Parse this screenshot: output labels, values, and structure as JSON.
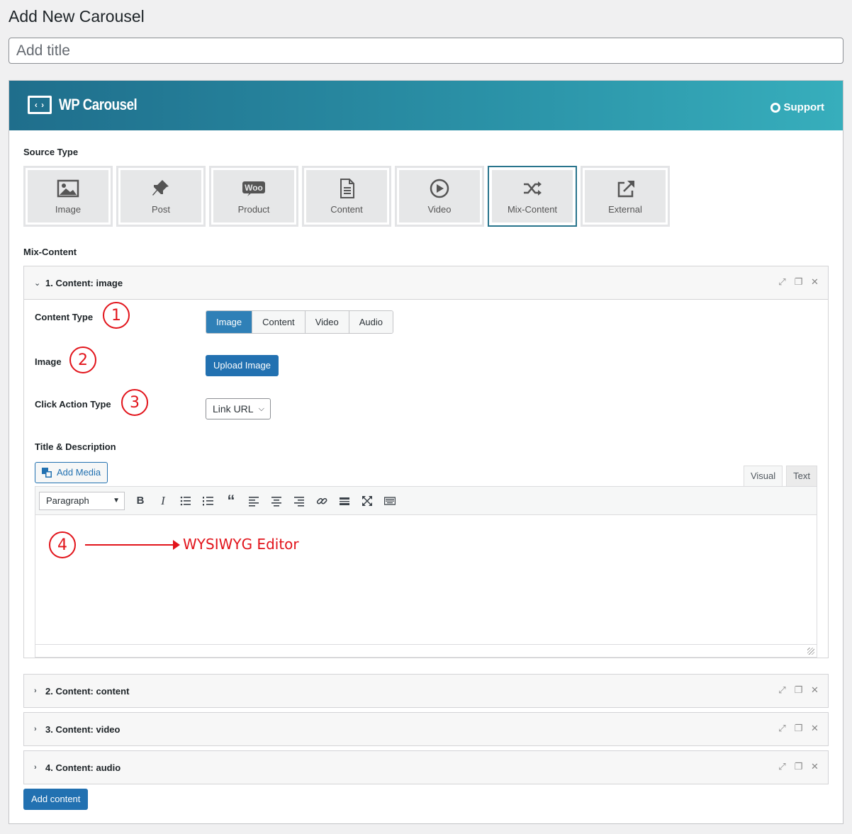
{
  "page": {
    "heading": "Add New Carousel",
    "title_placeholder": "Add title"
  },
  "header": {
    "logo_text": "WP Carousel",
    "support_label": "Support"
  },
  "source_type": {
    "label": "Source Type",
    "options": [
      {
        "label": "Image",
        "icon": "image-icon"
      },
      {
        "label": "Post",
        "icon": "pin-icon"
      },
      {
        "label": "Product",
        "icon": "woo-icon"
      },
      {
        "label": "Content",
        "icon": "document-icon"
      },
      {
        "label": "Video",
        "icon": "play-icon"
      },
      {
        "label": "Mix-Content",
        "icon": "shuffle-icon"
      },
      {
        "label": "External",
        "icon": "external-link-icon"
      }
    ],
    "selected": "Mix-Content"
  },
  "mix_content": {
    "label": "Mix-Content",
    "groups": [
      {
        "title": "1. Content: image",
        "expanded": true
      },
      {
        "title": "2. Content: content",
        "expanded": false
      },
      {
        "title": "3. Content: video",
        "expanded": false
      },
      {
        "title": "4. Content: audio",
        "expanded": false
      }
    ],
    "fields": {
      "content_type_label": "Content Type",
      "content_type_options": [
        "Image",
        "Content",
        "Video",
        "Audio"
      ],
      "content_type_selected": "Image",
      "image_label": "Image",
      "upload_button": "Upload Image",
      "click_action_label": "Click Action Type",
      "click_action_value": "Link URL",
      "title_desc_label": "Title & Description",
      "add_media": "Add Media",
      "tab_visual": "Visual",
      "tab_text": "Text",
      "format_select": "Paragraph"
    },
    "annotations": {
      "a1": "1",
      "a2": "2",
      "a3": "3",
      "a4": "4",
      "editor_note": "WYSIWYG Editor"
    },
    "add_button": "Add content"
  },
  "colors": {
    "accent": "#2271b1",
    "banner_start": "#1f6e8c",
    "banner_end": "#37aebc",
    "annotation": "#e2141b"
  }
}
